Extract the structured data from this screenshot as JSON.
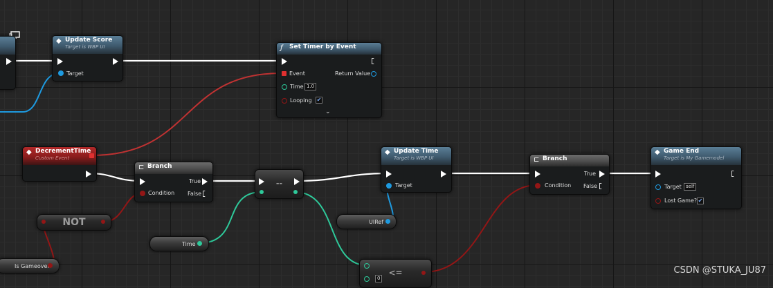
{
  "nodes": {
    "update_score": {
      "title": "Update Score",
      "subtitle": "Target is WBP UI",
      "pins": {
        "target": "Target"
      }
    },
    "set_timer": {
      "title": "Set Timer by Event",
      "pins": {
        "event": "Event",
        "return_value": "Return Value",
        "time": "Time",
        "time_value": "1.0",
        "looping": "Looping",
        "looping_checked": "✔"
      }
    },
    "decrement_time": {
      "title": "DecrementTime",
      "subtitle": "Custom Event"
    },
    "branch_1": {
      "title": "Branch",
      "pins": {
        "condition": "Condition",
        "true": "True",
        "false": "False"
      }
    },
    "equals": {
      "label": "--"
    },
    "update_time": {
      "title": "Update Time",
      "subtitle": "Target is WBP UI",
      "pins": {
        "target": "Target"
      }
    },
    "branch_2": {
      "title": "Branch",
      "pins": {
        "condition": "Condition",
        "true": "True",
        "false": "False"
      }
    },
    "game_end": {
      "title": "Game End",
      "subtitle": "Target is My Gamemodel",
      "pins": {
        "target": "Target",
        "target_value": "self",
        "lost_game": "Lost Game?",
        "lost_game_checked": "✔"
      }
    },
    "not_node": {
      "label": "NOT"
    },
    "less_equal": {
      "label": "<=",
      "b_value": "0"
    },
    "var_ui_ref": {
      "label": "UIRef"
    },
    "var_time": {
      "label": "Time"
    },
    "var_is_gameover": {
      "label": "Is Gameover"
    }
  },
  "icons": {
    "function": "ƒ",
    "branch": "⊏",
    "event": "◆"
  },
  "colors": {
    "exec": "#ffffff",
    "object": "#1e9ae0",
    "boolean": "#931616",
    "float": "#2ec99a",
    "delegate": "#e03030"
  },
  "watermark": "CSDN @STUKA_JU87"
}
